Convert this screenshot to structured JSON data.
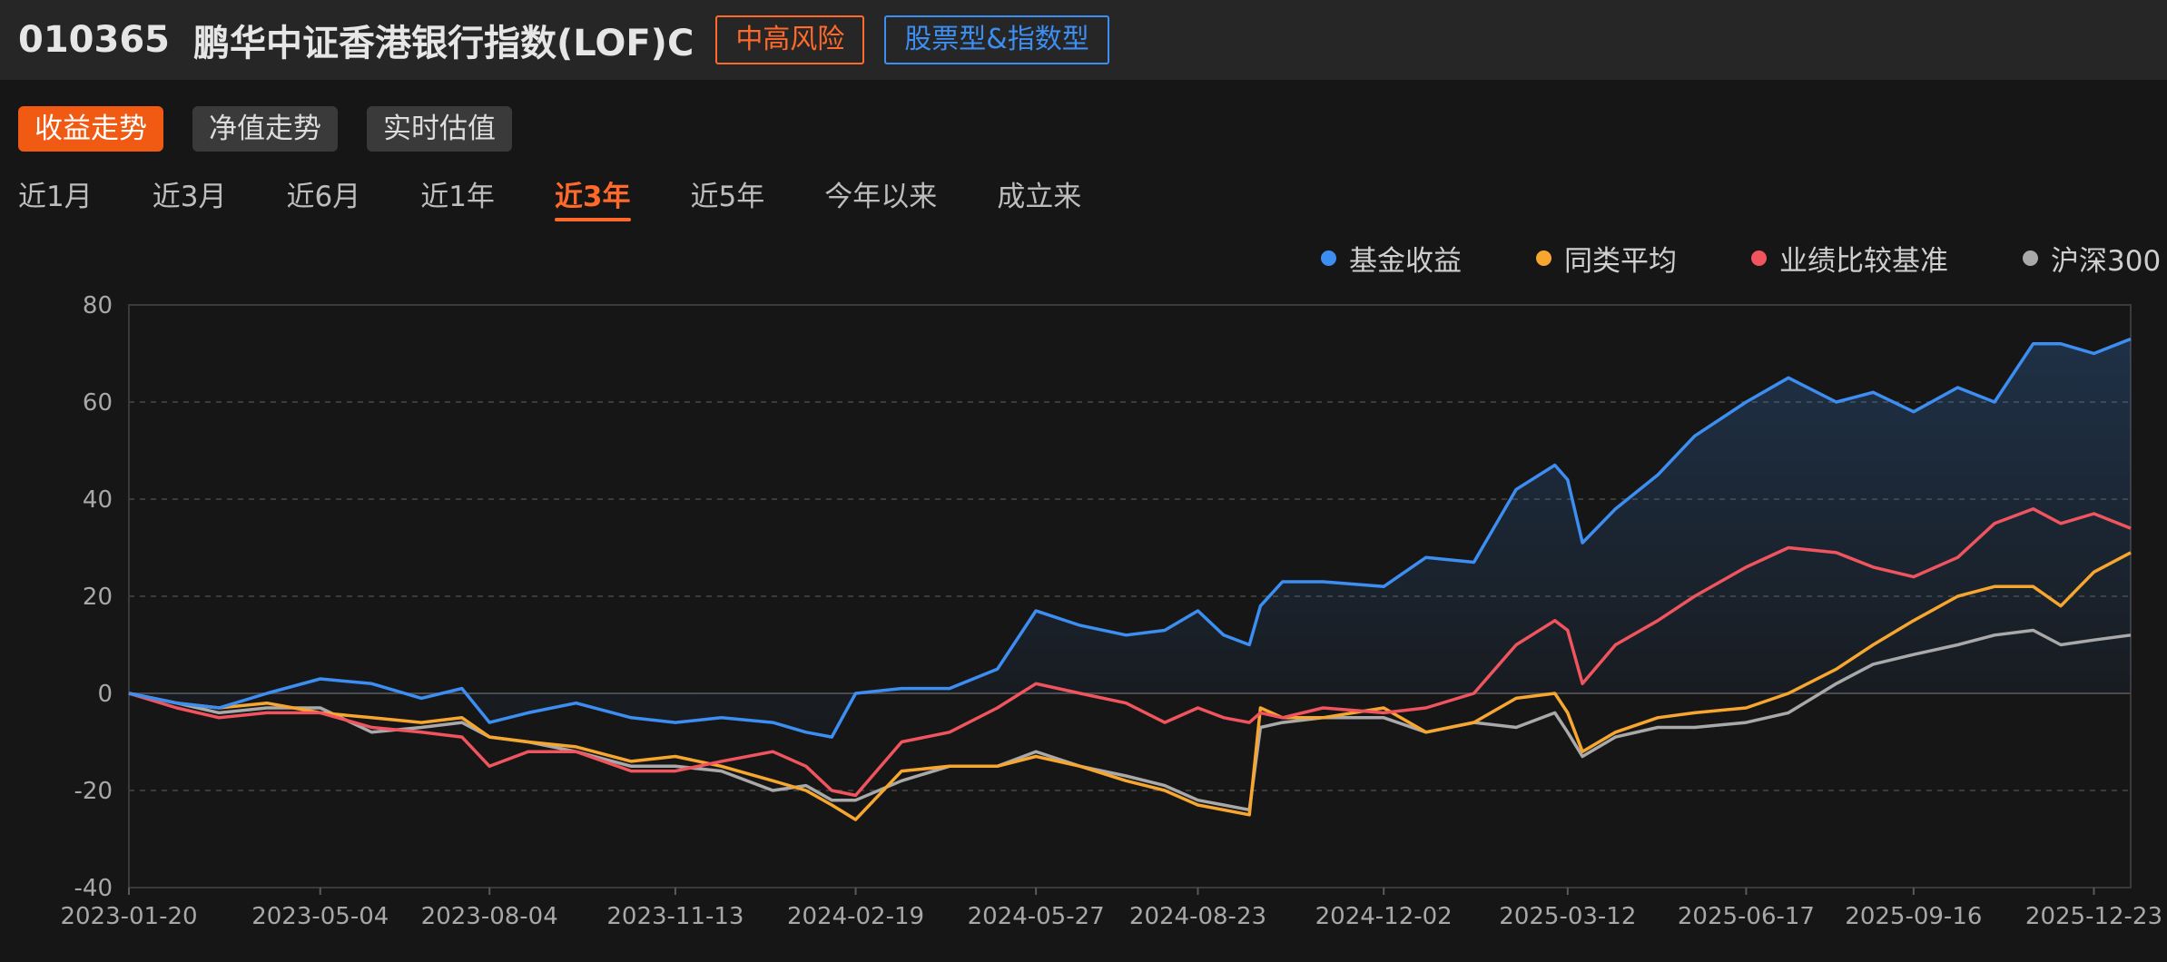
{
  "header": {
    "fund_code": "010365",
    "fund_name": "鹏华中证香港银行指数(LOF)C",
    "risk_badge": "中高风险",
    "type_badge": "股票型&指数型"
  },
  "tabs": [
    {
      "label": "收益走势",
      "active": true
    },
    {
      "label": "净值走势",
      "active": false
    },
    {
      "label": "实时估值",
      "active": false
    }
  ],
  "periods": [
    {
      "label": "近1月",
      "active": false
    },
    {
      "label": "近3月",
      "active": false
    },
    {
      "label": "近6月",
      "active": false
    },
    {
      "label": "近1年",
      "active": false
    },
    {
      "label": "近3年",
      "active": true
    },
    {
      "label": "近5年",
      "active": false
    },
    {
      "label": "今年以来",
      "active": false
    },
    {
      "label": "成立来",
      "active": false
    }
  ],
  "colors": {
    "accent": "#f05a12",
    "fund": "#3d8ef2",
    "peer": "#f7a72f",
    "benchmark": "#f0545e",
    "hs300": "#a9a9a9"
  },
  "chart_data": {
    "type": "line",
    "title": "",
    "xlabel": "",
    "ylabel": "",
    "y_unit": "%",
    "ylim": [
      -40,
      80
    ],
    "yticks": [
      80,
      60,
      40,
      20,
      0,
      -20,
      -40
    ],
    "xlim": [
      "2023-01-20",
      "2026-01-12"
    ],
    "xticks": [
      "2023-01-20",
      "2023-05-04",
      "2023-08-04",
      "2023-11-13",
      "2024-02-19",
      "2024-05-27",
      "2024-08-23",
      "2024-12-02",
      "2025-03-12",
      "2025-06-17",
      "2025-09-16",
      "2025-12-23"
    ],
    "grid": "horizontal dashed",
    "legend": "top-right",
    "area_fill_series": "基金收益",
    "x": [
      "2023-01-20",
      "2023-02-15",
      "2023-03-10",
      "2023-04-05",
      "2023-05-04",
      "2023-06-01",
      "2023-06-28",
      "2023-07-20",
      "2023-08-04",
      "2023-08-25",
      "2023-09-20",
      "2023-10-20",
      "2023-11-13",
      "2023-12-08",
      "2024-01-05",
      "2024-01-23",
      "2024-02-06",
      "2024-02-19",
      "2024-03-15",
      "2024-04-10",
      "2024-05-06",
      "2024-05-27",
      "2024-06-20",
      "2024-07-15",
      "2024-08-05",
      "2024-08-23",
      "2024-09-06",
      "2024-09-20",
      "2024-09-26",
      "2024-10-08",
      "2024-10-30",
      "2024-12-02",
      "2024-12-25",
      "2025-01-20",
      "2025-02-12",
      "2025-03-05",
      "2025-03-12",
      "2025-03-20",
      "2025-04-07",
      "2025-04-30",
      "2025-05-20",
      "2025-06-17",
      "2025-07-10",
      "2025-08-05",
      "2025-08-25",
      "2025-09-16",
      "2025-10-10",
      "2025-10-30",
      "2025-11-20",
      "2025-12-05",
      "2025-12-23",
      "2026-01-12"
    ],
    "series": [
      {
        "name": "基金收益",
        "color": "#3d8ef2",
        "values": [
          0,
          -2,
          -3,
          0,
          3,
          2,
          -1,
          1,
          -6,
          -4,
          -2,
          -5,
          -6,
          -5,
          -6,
          -8,
          -9,
          0,
          1,
          1,
          5,
          17,
          14,
          12,
          13,
          17,
          12,
          10,
          18,
          23,
          23,
          22,
          28,
          27,
          42,
          47,
          44,
          31,
          38,
          45,
          53,
          60,
          65,
          60,
          62,
          58,
          63,
          60,
          72,
          72,
          70,
          73
        ]
      },
      {
        "name": "同类平均",
        "color": "#f7a72f",
        "values": [
          0,
          -2,
          -3,
          -2,
          -4,
          -5,
          -6,
          -5,
          -9,
          -10,
          -11,
          -14,
          -13,
          -15,
          -18,
          -20,
          -23,
          -26,
          -16,
          -15,
          -15,
          -13,
          -15,
          -18,
          -20,
          -23,
          -24,
          -25,
          -3,
          -5,
          -5,
          -3,
          -8,
          -6,
          -1,
          0,
          -4,
          -12,
          -8,
          -5,
          -4,
          -3,
          0,
          5,
          10,
          15,
          20,
          22,
          22,
          18,
          25,
          29
        ]
      },
      {
        "name": "业绩比较基准",
        "color": "#f0545e",
        "values": [
          0,
          -3,
          -5,
          -4,
          -4,
          -7,
          -8,
          -9,
          -15,
          -12,
          -12,
          -16,
          -16,
          -14,
          -12,
          -15,
          -20,
          -21,
          -10,
          -8,
          -3,
          2,
          0,
          -2,
          -6,
          -3,
          -5,
          -6,
          -4,
          -5,
          -3,
          -4,
          -3,
          0,
          10,
          15,
          13,
          2,
          10,
          15,
          20,
          26,
          30,
          29,
          26,
          24,
          28,
          35,
          38,
          35,
          37,
          34
        ]
      },
      {
        "name": "沪深300",
        "color": "#a9a9a9",
        "values": [
          0,
          -2,
          -4,
          -3,
          -3,
          -8,
          -7,
          -6,
          -9,
          -10,
          -12,
          -15,
          -15,
          -16,
          -20,
          -19,
          -22,
          -22,
          -18,
          -15,
          -15,
          -12,
          -15,
          -17,
          -19,
          -22,
          -23,
          -24,
          -7,
          -6,
          -5,
          -5,
          -8,
          -6,
          -7,
          -4,
          -8,
          -13,
          -9,
          -7,
          -7,
          -6,
          -4,
          2,
          6,
          8,
          10,
          12,
          13,
          10,
          11,
          12
        ]
      }
    ]
  }
}
